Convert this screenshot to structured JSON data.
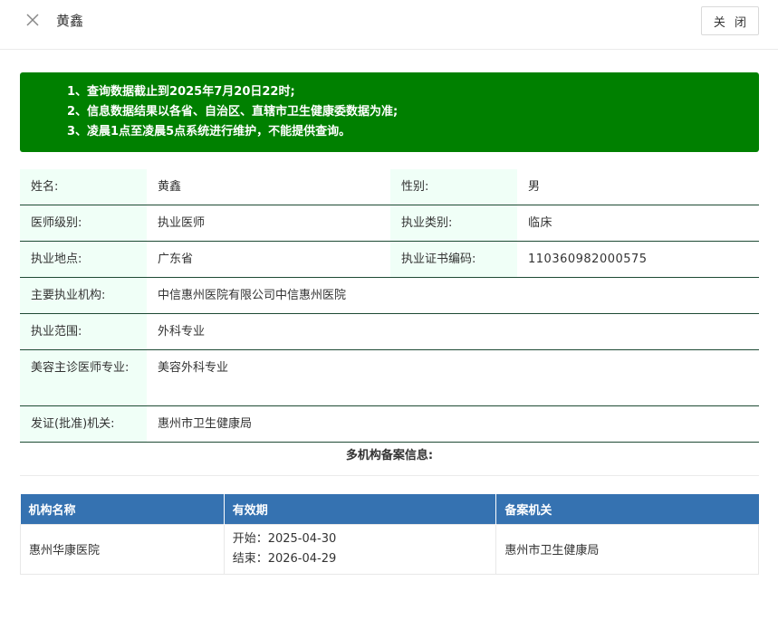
{
  "header": {
    "title": "黄鑫",
    "close_button": "关 闭"
  },
  "notice": [
    "1、查询数据截止到2025年7月20日22时;",
    "2、信息数据结果以各省、自治区、直辖市卫生健康委数据为准;",
    "3、凌晨1点至凌晨5点系统进行维护，不能提供查询。"
  ],
  "info": {
    "name_label": "姓名:",
    "name_value": "黄鑫",
    "gender_label": "性别:",
    "gender_value": "男",
    "level_label": "医师级别:",
    "level_value": "执业医师",
    "category_label": "执业类别:",
    "category_value": "临床",
    "place_label": "执业地点:",
    "place_value": "广东省",
    "cert_label": "执业证书编码:",
    "cert_value": "110360982000575",
    "org_label": "主要执业机构:",
    "org_value": "中信惠州医院有限公司中信惠州医院",
    "scope_label": "执业范围:",
    "scope_value": "外科专业",
    "cosmetic_label": "美容主诊医师专业:",
    "cosmetic_value": "美容外科专业",
    "issuer_label": "发证(批准)机关:",
    "issuer_value": "惠州市卫生健康局"
  },
  "multi_title": "多机构备案信息:",
  "org_table": {
    "headers": [
      "机构名称",
      "有效期",
      "备案机关"
    ],
    "rows": [
      {
        "org": "惠州华康医院",
        "start": "开始：2025-04-30",
        "end": "结束：2026-04-29",
        "authority": "惠州市卫生健康局"
      }
    ]
  }
}
